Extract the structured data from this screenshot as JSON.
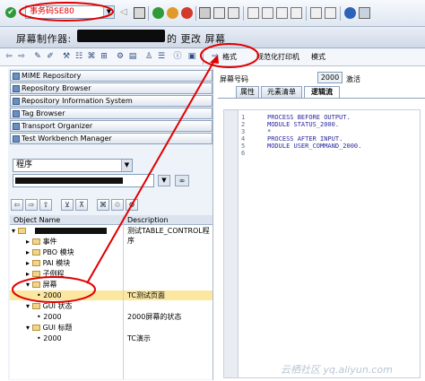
{
  "toolbar": {
    "command_value": "事务码SE80",
    "dropdown_glyph": "▼"
  },
  "title": {
    "prefix": "屏幕制作器:",
    "suffix": "的 更改 屏幕"
  },
  "app_toolbar": {
    "format_button": "格式",
    "normalize_print": "规范化打印机",
    "mode": "模式"
  },
  "nav": [
    {
      "label": "MIME Repository"
    },
    {
      "label": "Repository Browser"
    },
    {
      "label": "Repository Information System"
    },
    {
      "label": "Tag Browser"
    },
    {
      "label": "Transport Organizer"
    },
    {
      "label": "Test Workbench Manager"
    }
  ],
  "object_select": {
    "type_value": "程序",
    "arrow": "▼"
  },
  "tree": {
    "col_name": "Object Name",
    "col_desc": "Description",
    "rows": [
      {
        "name": "",
        "desc": "测试TABLE_CONTROL程序"
      },
      {
        "name": "事件",
        "desc": ""
      },
      {
        "name": "PBO 模块",
        "desc": ""
      },
      {
        "name": "PAI 模块",
        "desc": ""
      },
      {
        "name": "子例程",
        "desc": ""
      },
      {
        "name": "屏幕",
        "desc": ""
      },
      {
        "name": "2000",
        "desc": "TC测试页面"
      },
      {
        "name": "GUI 状态",
        "desc": ""
      },
      {
        "name": "2000",
        "desc": "2000屏幕的状态"
      },
      {
        "name": "GUI 标题",
        "desc": ""
      },
      {
        "name": "2000",
        "desc": "TC演示"
      }
    ]
  },
  "screen": {
    "label": "屏幕号码",
    "number": "2000",
    "status": "激活"
  },
  "tabs": [
    "属性",
    "元素清单",
    "逻辑流"
  ],
  "code_lines": [
    {
      "num": "1",
      "text": "PROCESS BEFORE OUTPUT."
    },
    {
      "num": "2",
      "text": " MODULE STATUS_2000."
    },
    {
      "num": "3",
      "text": "*"
    },
    {
      "num": "4",
      "text": "PROCESS AFTER INPUT."
    },
    {
      "num": "5",
      "text": " MODULE USER_COMMAND_2000."
    },
    {
      "num": "6",
      "text": ""
    }
  ],
  "watermark": "云栖社区 yq.aliyun.com",
  "colors": {
    "accent_red": "#e00000",
    "selected_row": "#fbe7a0"
  }
}
